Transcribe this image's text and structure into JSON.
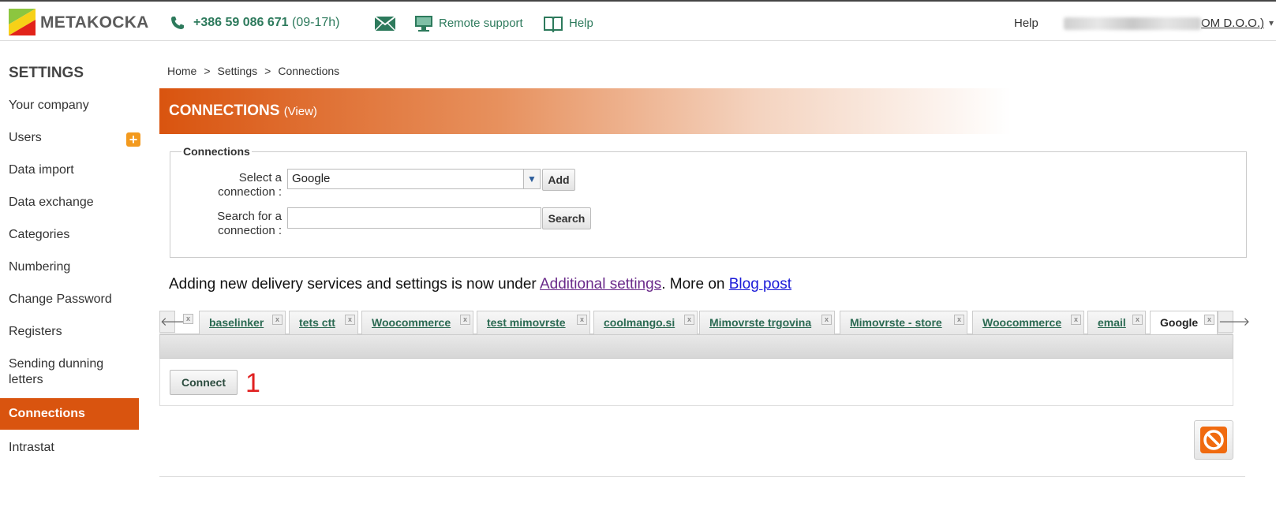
{
  "header": {
    "brand": "METAKOCKA",
    "phone": "+386 59 086 671",
    "phone_hours": "(09-17h)",
    "remote_support": "Remote support",
    "help": "Help",
    "help_right": "Help",
    "account_suffix": "OM D.O.O.)",
    "colors": {
      "accent": "#d9540f",
      "link_green": "#2d7a5c"
    }
  },
  "sidebar": {
    "title": "SETTINGS",
    "items": [
      {
        "label": "Your company"
      },
      {
        "label": "Users"
      },
      {
        "label": "Data import"
      },
      {
        "label": "Data exchange"
      },
      {
        "label": "Categories"
      },
      {
        "label": "Numbering"
      },
      {
        "label": "Change Password"
      },
      {
        "label": "Registers"
      },
      {
        "label": "Sending dunning letters"
      },
      {
        "label": "Connections",
        "active": true
      },
      {
        "label": "Intrastat"
      }
    ]
  },
  "breadcrumb": {
    "items": [
      "Home",
      "Settings",
      "Connections"
    ],
    "separator": ">"
  },
  "banner": {
    "title": "CONNECTIONS",
    "view_link": "(View)"
  },
  "connections_form": {
    "legend": "Connections",
    "select_label_1": "Select a",
    "select_label_2": "connection :",
    "select_value": "Google",
    "add_label": "Add",
    "search_label_1": "Search for a",
    "search_label_2": "connection :",
    "search_value": "",
    "search_button": "Search"
  },
  "info": {
    "text_before": "Adding new delivery services and settings is now under ",
    "link1": "Additional settings",
    "text_middle": ". More on ",
    "link2": "Blog post"
  },
  "tabs": [
    {
      "label": "baselinker"
    },
    {
      "label": "tets ctt"
    },
    {
      "label": "Woocommerce"
    },
    {
      "label": "test mimovrste"
    },
    {
      "label": "coolmango.si"
    },
    {
      "label": "Mimovrste trgovina"
    },
    {
      "label": "Mimovrste - store"
    },
    {
      "label": "Woocommerce"
    },
    {
      "label": "email"
    },
    {
      "label": "Google",
      "active": true
    }
  ],
  "tab_close_glyph": "x",
  "panel": {
    "connect_button": "Connect",
    "marker": "1"
  }
}
